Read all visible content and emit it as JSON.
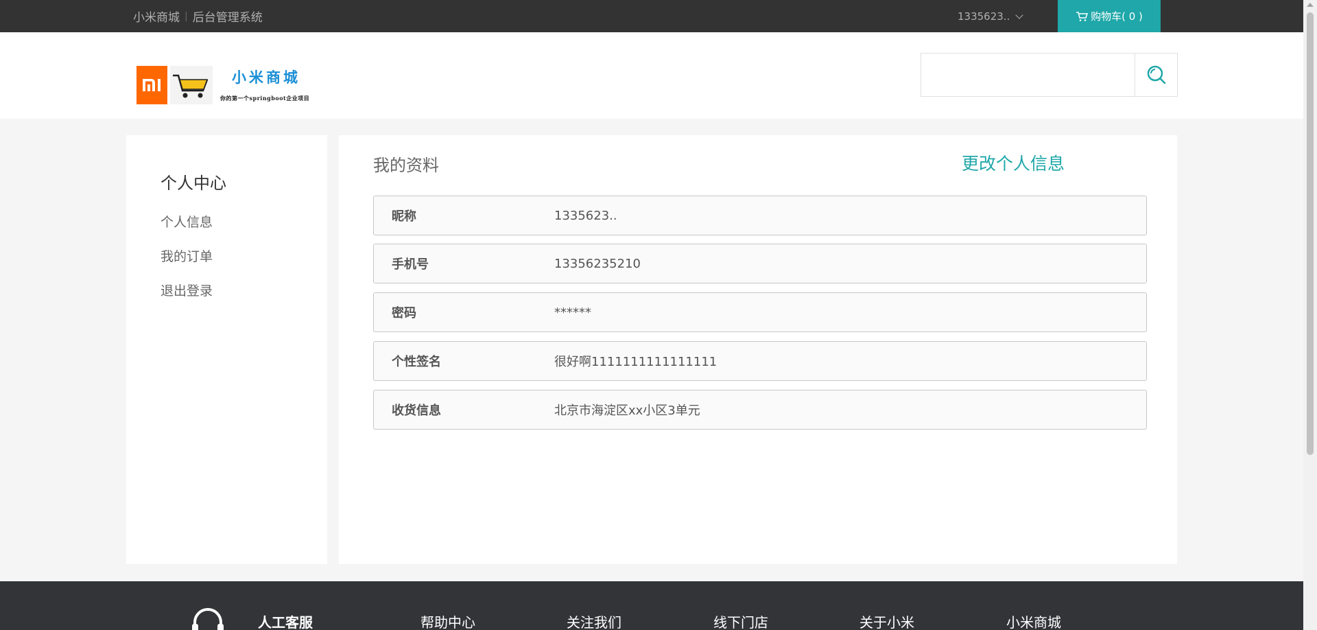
{
  "topbar": {
    "store_link": "小米商城",
    "separator": "|",
    "admin_link": "后台管理系统",
    "username": "1335623..",
    "cart_label": "购物车( 0 )"
  },
  "brand": {
    "title": "小米商城",
    "subtitle": "你的第一个springboot企业项目"
  },
  "search": {
    "placeholder": ""
  },
  "sidebar": {
    "title": "个人中心",
    "items": [
      {
        "label": "个人信息"
      },
      {
        "label": "我的订单"
      },
      {
        "label": "退出登录"
      }
    ]
  },
  "profile": {
    "heading": "我的资料",
    "edit_label": "更改个人信息",
    "rows": [
      {
        "key": "昵称",
        "value": "1335623.."
      },
      {
        "key": "手机号",
        "value": "13356235210"
      },
      {
        "key": "密码",
        "value": "******"
      },
      {
        "key": "个性签名",
        "value": "很好啊1111111111111111"
      },
      {
        "key": "收货信息",
        "value": "北京市海淀区xx小区3单元"
      }
    ]
  },
  "footer": {
    "columns": [
      {
        "label": "人工客服"
      },
      {
        "label": "帮助中心"
      },
      {
        "label": "关注我们"
      },
      {
        "label": "线下门店"
      },
      {
        "label": "关于小米"
      },
      {
        "label": "小米商城"
      }
    ]
  },
  "colors": {
    "accent": "#1fa7a9",
    "topbar": "#333333",
    "mi_orange": "#ff6700",
    "brand_blue": "#1b8fd6"
  }
}
